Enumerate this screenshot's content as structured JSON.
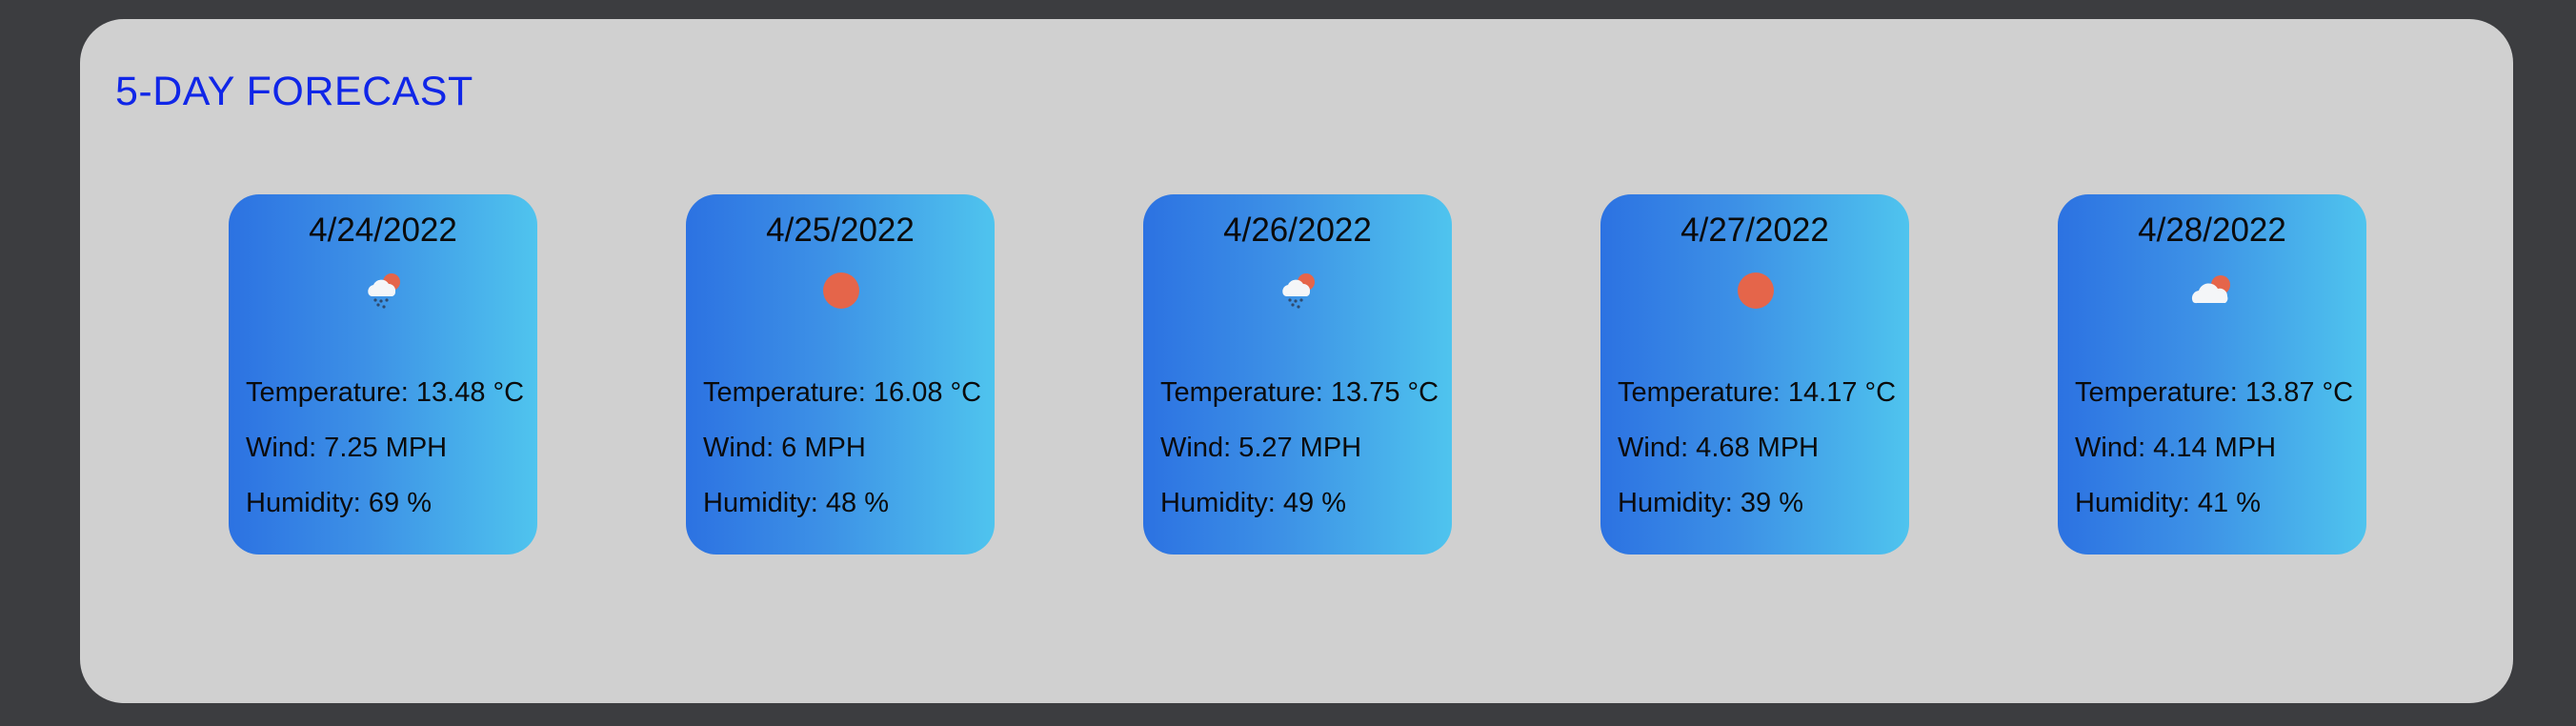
{
  "forecast": {
    "title": "5-DAY FORECAST",
    "days": [
      {
        "date": "4/24/2022",
        "icon": "cloud-rain-sun-icon",
        "temperature": "Temperature: 13.48 °C",
        "wind": "Wind: 7.25 MPH",
        "humidity": "Humidity: 69 %"
      },
      {
        "date": "4/25/2022",
        "icon": "sun-icon",
        "temperature": "Temperature: 16.08 °C",
        "wind": "Wind: 6 MPH",
        "humidity": "Humidity: 48 %"
      },
      {
        "date": "4/26/2022",
        "icon": "cloud-rain-sun-icon",
        "temperature": "Temperature: 13.75 °C",
        "wind": "Wind: 5.27 MPH",
        "humidity": "Humidity: 49 %"
      },
      {
        "date": "4/27/2022",
        "icon": "sun-icon",
        "temperature": "Temperature: 14.17 °C",
        "wind": "Wind: 4.68 MPH",
        "humidity": "Humidity: 39 %"
      },
      {
        "date": "4/28/2022",
        "icon": "cloud-sun-icon",
        "temperature": "Temperature: 13.87 °C",
        "wind": "Wind: 4.14 MPH",
        "humidity": "Humidity: 41 %"
      }
    ]
  },
  "colors": {
    "page_background": "#3c3d40",
    "panel_background": "#d0d0d0",
    "title": "#1026e8",
    "card_gradient_start": "#2c72e2",
    "card_gradient_end": "#4fc4ee",
    "sun": "#e5654a",
    "cloud": "#f4f6f8",
    "rain": "#2e4a6e"
  }
}
